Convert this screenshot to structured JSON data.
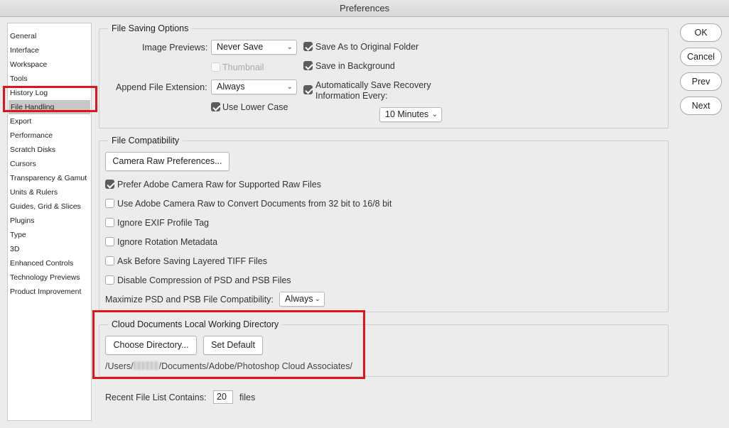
{
  "window": {
    "title": "Preferences"
  },
  "sidebar": {
    "items": [
      {
        "label": "General"
      },
      {
        "label": "Interface"
      },
      {
        "label": "Workspace"
      },
      {
        "label": "Tools"
      },
      {
        "label": "History Log"
      },
      {
        "label": "File Handling",
        "selected": true
      },
      {
        "label": "Export"
      },
      {
        "label": "Performance"
      },
      {
        "label": "Scratch Disks"
      },
      {
        "label": "Cursors"
      },
      {
        "label": "Transparency & Gamut"
      },
      {
        "label": "Units & Rulers"
      },
      {
        "label": "Guides, Grid & Slices"
      },
      {
        "label": "Plugins"
      },
      {
        "label": "Type"
      },
      {
        "label": "3D"
      },
      {
        "label": "Enhanced Controls"
      },
      {
        "label": "Technology Previews"
      },
      {
        "label": "Product Improvement"
      }
    ]
  },
  "file_saving": {
    "title": "File Saving Options",
    "image_previews_label": "Image Previews:",
    "image_previews_value": "Never Save",
    "thumbnail_label": "Thumbnail",
    "append_ext_label": "Append File Extension:",
    "append_ext_value": "Always",
    "lower_case_label": "Use Lower Case",
    "save_as_original_label": "Save As to Original Folder",
    "save_background_label": "Save in Background",
    "auto_save_label_1": "Automatically Save Recovery",
    "auto_save_label_2": "Information Every:",
    "auto_save_interval": "10 Minutes"
  },
  "compat": {
    "title": "File Compatibility",
    "camera_raw_button": "Camera Raw Preferences...",
    "options": [
      {
        "label": "Prefer Adobe Camera Raw for Supported Raw Files",
        "checked": true
      },
      {
        "label": "Use Adobe Camera Raw to Convert Documents from 32 bit to 16/8 bit",
        "checked": false
      },
      {
        "label": "Ignore EXIF Profile Tag",
        "checked": false
      },
      {
        "label": "Ignore Rotation Metadata",
        "checked": false
      },
      {
        "label": "Ask Before Saving Layered TIFF Files",
        "checked": false
      },
      {
        "label": "Disable Compression of PSD and PSB Files",
        "checked": false
      }
    ],
    "maximize_label": "Maximize PSD and PSB File Compatibility:",
    "maximize_value": "Always"
  },
  "cloud": {
    "title": "Cloud Documents Local Working Directory",
    "choose_button": "Choose Directory...",
    "default_button": "Set Default",
    "path_prefix": "/Users/",
    "path_suffix": "/Documents/Adobe/Photoshop Cloud Associates/"
  },
  "recent": {
    "label": "Recent File List Contains:",
    "value": "20",
    "unit": "files"
  },
  "actions": {
    "ok": "OK",
    "cancel": "Cancel",
    "prev": "Prev",
    "next": "Next"
  },
  "colors": {
    "highlight": "#e0141e",
    "selected_item": "#c8c8c8",
    "checkbox_checked": "#5c5c5c"
  }
}
